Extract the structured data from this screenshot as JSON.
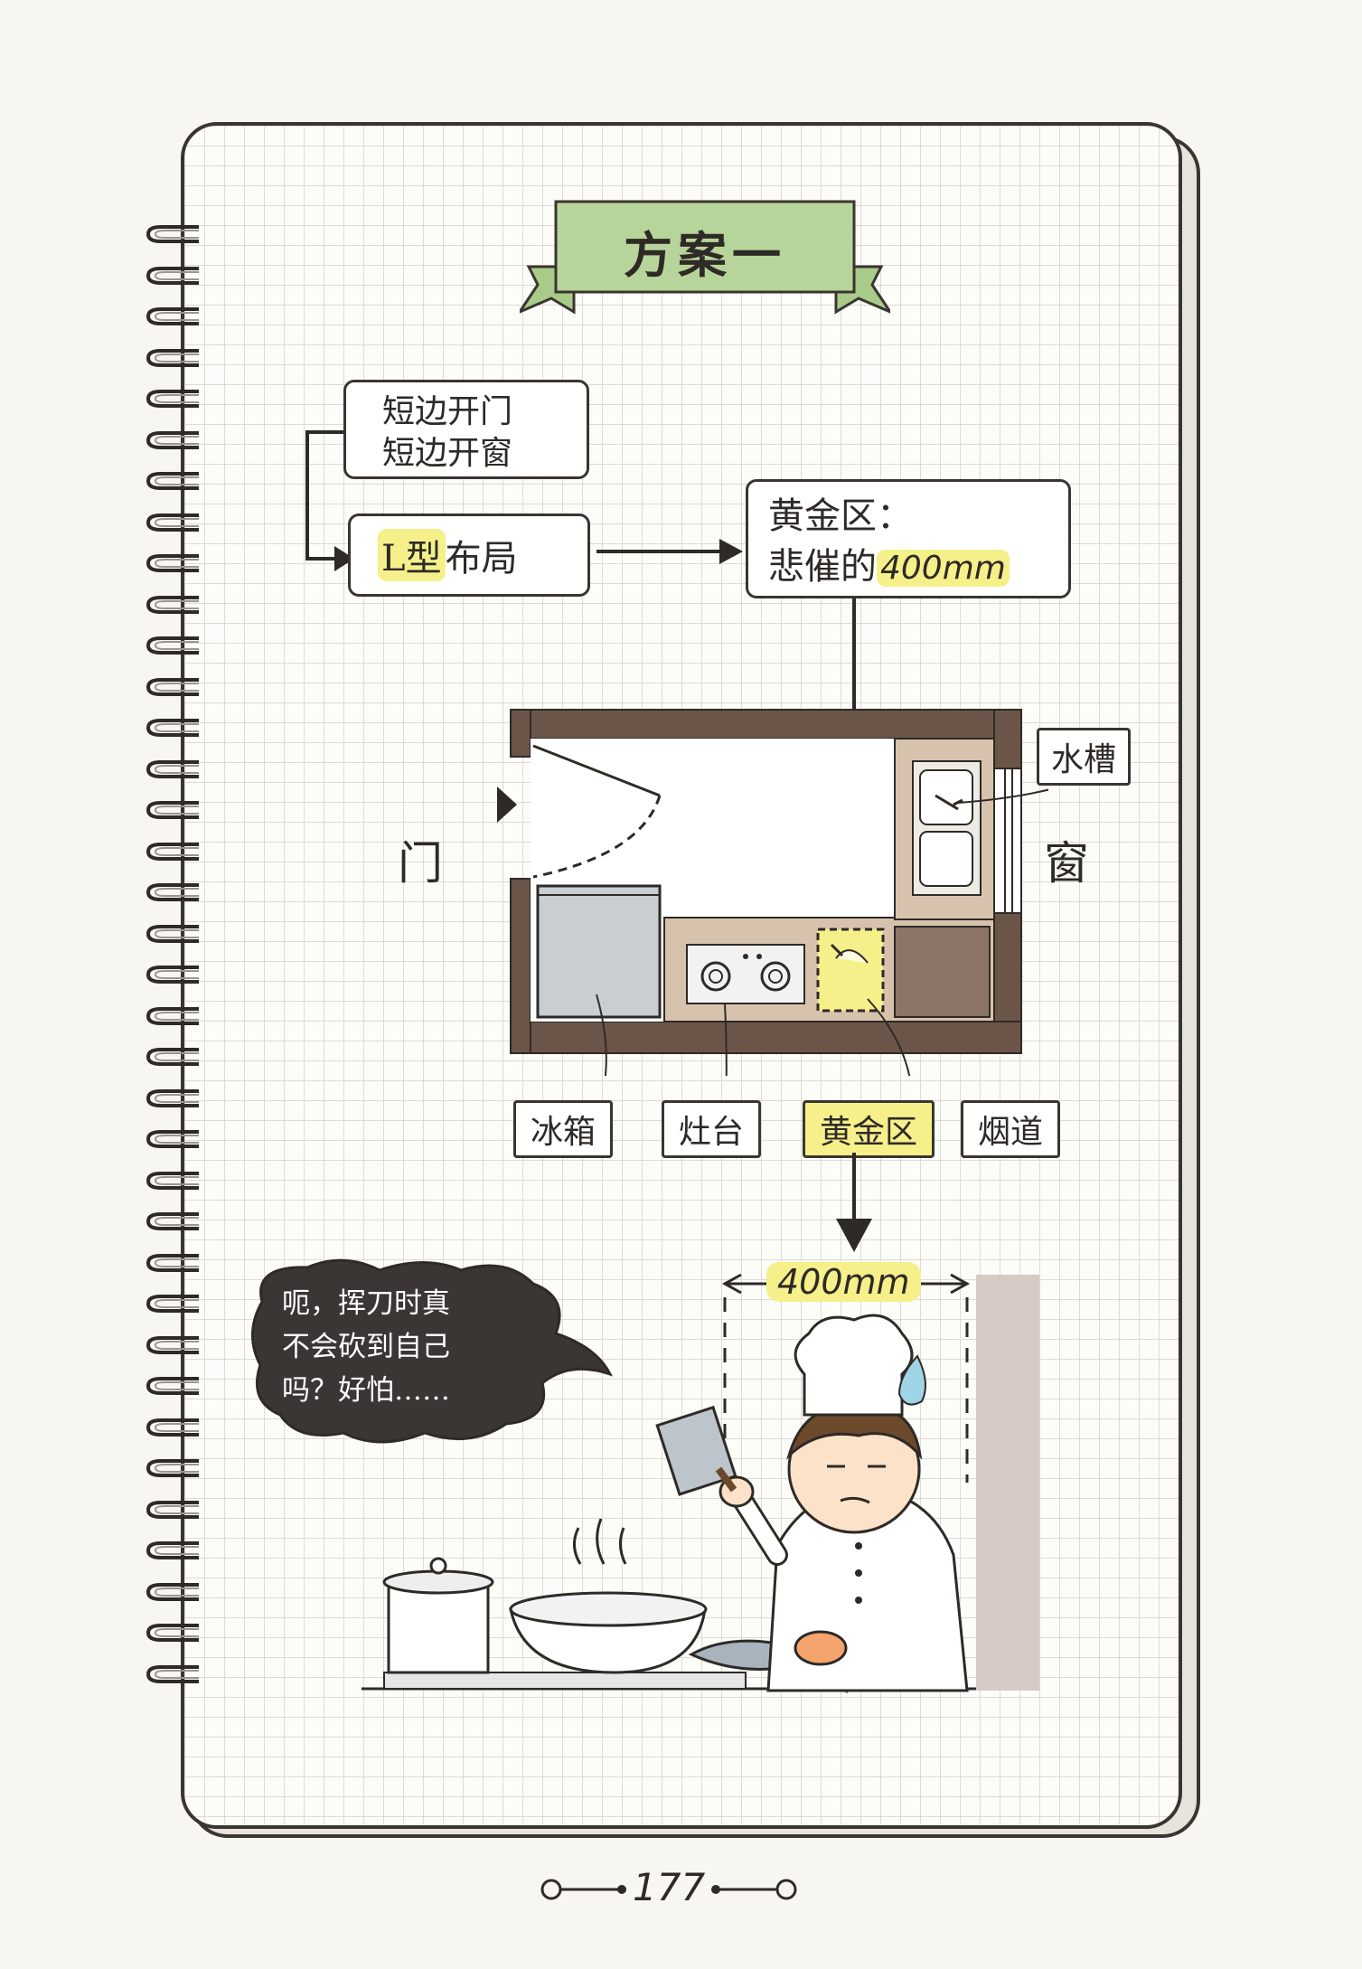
{
  "title": "方案一",
  "flow": {
    "condition_line1": "短边开门",
    "condition_line2": "短边开窗",
    "layout_highlight": "L型",
    "layout_rest": "布局",
    "golden_line1": "黄金区：",
    "golden_line2_prefix": "悲催的",
    "golden_line2_value": "400mm"
  },
  "plan": {
    "door_label": "门",
    "window_label": "窗",
    "sink_label": "水槽",
    "fridge_label": "冰箱",
    "stove_label": "灶台",
    "golden_label": "黄金区",
    "flue_label": "烟道"
  },
  "cartoon": {
    "dimension": "400mm",
    "speech_line1": "呃，挥刀时真",
    "speech_line2": "不会砍到自己",
    "speech_line3": "吗？好怕……"
  },
  "page_number": "177",
  "colors": {
    "ribbon_green": "#b7d59a",
    "highlight_yellow": "#f5f08a",
    "wall_brown": "#6b5548",
    "counter_tan": "#d7c3ad",
    "fridge_gray": "#c9ced3",
    "ink": "#2e2a26"
  }
}
